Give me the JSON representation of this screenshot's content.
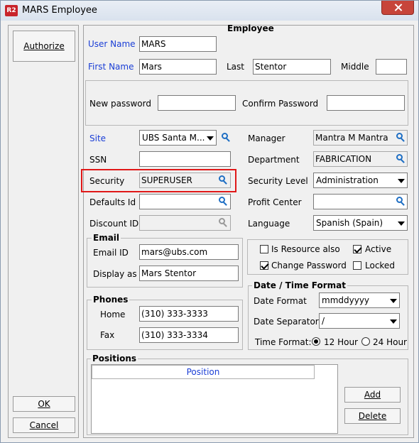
{
  "window": {
    "title": "MARS Employee",
    "app_badge": "R2"
  },
  "left_panel": {
    "authorize": "Authorize",
    "ok": "OK",
    "cancel": "Cancel"
  },
  "section_title": "Employee",
  "user": {
    "user_name_label": "User Name",
    "user_name": "MARS",
    "first_name_label": "First Name",
    "first_name": "Mars",
    "last_label": "Last",
    "last_name": "Stentor",
    "middle_label": "Middle",
    "middle_name": ""
  },
  "password": {
    "new_label": "New password",
    "new_value": "",
    "confirm_label": "Confirm Password",
    "confirm_value": ""
  },
  "left_fields": {
    "site_label": "Site",
    "site": "UBS Santa M...",
    "ssn_label": "SSN",
    "ssn": "",
    "security_label": "Security",
    "security": "SUPERUSER",
    "defaults_label": "Defaults Id",
    "defaults": "",
    "discount_label": "Discount ID",
    "discount": ""
  },
  "right_fields": {
    "manager_label": "Manager",
    "manager": "Mantra M Mantra",
    "department_label": "Department",
    "department": "FABRICATION",
    "security_level_label": "Security Level",
    "security_level": "Administration",
    "profit_center_label": "Profit  Center",
    "profit_center": "",
    "language_label": "Language",
    "language": "Spanish (Spain)"
  },
  "email": {
    "group": "Email",
    "email_label": "Email ID",
    "email": "mars@ubs.com",
    "display_label": "Display as",
    "display": "Mars Stentor"
  },
  "flags": {
    "is_resource": "Is Resource also",
    "is_resource_checked": false,
    "active": "Active",
    "active_checked": true,
    "change_password": "Change  Password",
    "change_password_checked": true,
    "locked": "Locked",
    "locked_checked": false
  },
  "phones": {
    "group": "Phones",
    "home_label": "Home",
    "home": "(310) 333-3333",
    "fax_label": "Fax",
    "fax": "(310) 333-3334"
  },
  "datetime": {
    "group": "Date / Time Format",
    "date_format_label": "Date Format",
    "date_format": "mmddyyyy",
    "date_sep_label": "Date Separator",
    "date_sep": "/",
    "time_format_label": "Time Format:",
    "opt12": "12 Hour",
    "opt24": "24 Hour",
    "selected": "12 Hour"
  },
  "positions": {
    "group": "Positions",
    "column": "Position",
    "add": "Add",
    "delete": "Delete"
  },
  "colors": {
    "title_bar": "#dbe4f0",
    "close_button": "#c7453a",
    "label_blue": "#1a3ed6",
    "highlight_red": "#e01818",
    "icon_blue": "#1f6fc4"
  }
}
